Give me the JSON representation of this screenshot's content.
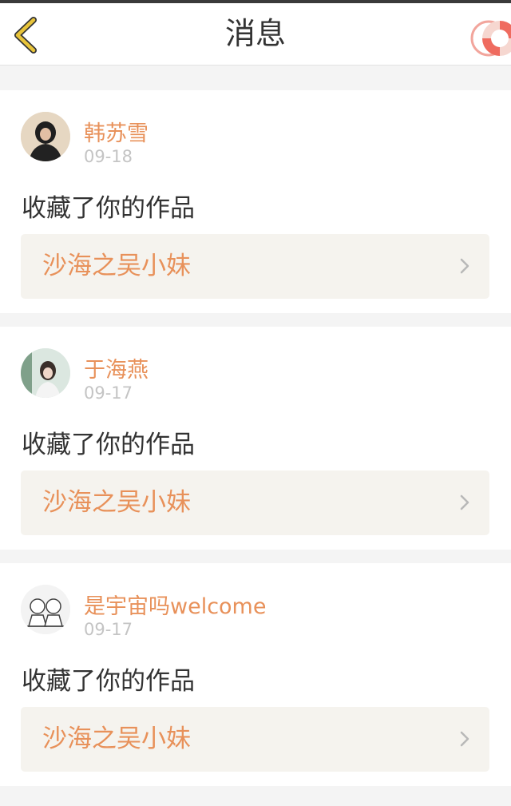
{
  "header": {
    "title": "消息",
    "back_icon": "chevron-left-icon",
    "help_icon": "lifebuoy-icon",
    "accent_color": "#e8c43a"
  },
  "notifications": [
    {
      "user_name": "韩苏雪",
      "date": "09-18",
      "action": "收藏了你的作品",
      "work_title": "沙海之吴小妹"
    },
    {
      "user_name": "于海燕",
      "date": "09-17",
      "action": "收藏了你的作品",
      "work_title": "沙海之吴小妹"
    },
    {
      "user_name": "是宇宙吗welcome",
      "date": "09-17",
      "action": "收藏了你的作品",
      "work_title": "沙海之吴小妹"
    }
  ],
  "colors": {
    "name": "#e8915a",
    "work_title": "#e8915a",
    "date": "#c4c4c4",
    "text": "#333333",
    "page_bg": "#f4f4f4"
  }
}
